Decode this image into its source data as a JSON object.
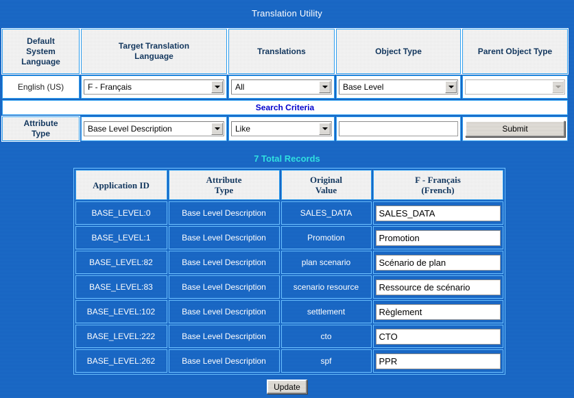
{
  "page": {
    "title": "Translation Utility",
    "background_color": "#1565c5",
    "accent_cyan": "#2fe0e0",
    "accent_blue": "#0000cc",
    "header_text_color": "#13375e"
  },
  "criteria": {
    "headers": [
      "Default System Language",
      "Target Translation Language",
      "Translations",
      "Object Type",
      "Parent Object Type"
    ],
    "header_lines": {
      "default_system_language": [
        "Default",
        "System",
        "Language"
      ],
      "target_translation_language": [
        "Target Translation",
        "Language"
      ],
      "translations": [
        "Translations"
      ],
      "object_type": [
        "Object Type"
      ],
      "parent_object_type": [
        "Parent Object Type"
      ]
    },
    "default_system_language_value": "English (US)",
    "target_translation_language_value": "F - Français",
    "translations_value": "All",
    "object_type_value": "Base Level",
    "parent_object_type_value": ""
  },
  "search": {
    "banner": "Search Criteria",
    "attribute_type_label_lines": [
      "Attribute",
      "Type"
    ],
    "attribute_type_label": "Attribute Type",
    "attribute_type_value": "Base Level Description",
    "operator_value": "Like",
    "search_text_value": "",
    "search_text_placeholder": "",
    "submit_label": "Submit"
  },
  "results": {
    "total_records_text": "7 Total Records",
    "columns": [
      {
        "lines": [
          "Application ID"
        ],
        "text": "Application ID"
      },
      {
        "lines": [
          "Attribute",
          "Type"
        ],
        "text": "Attribute Type"
      },
      {
        "lines": [
          "Original",
          "Value"
        ],
        "text": "Original Value"
      },
      {
        "lines": [
          "F - Français",
          "(French)"
        ],
        "text": "F - Français (French)"
      }
    ],
    "rows": [
      {
        "application_id": "BASE_LEVEL:0",
        "attribute_type": "Base Level Description",
        "original_value": "SALES_DATA",
        "translation": "SALES_DATA"
      },
      {
        "application_id": "BASE_LEVEL:1",
        "attribute_type": "Base Level Description",
        "original_value": "Promotion",
        "translation": "Promotion"
      },
      {
        "application_id": "BASE_LEVEL:82",
        "attribute_type": "Base Level Description",
        "original_value": "plan scenario",
        "translation": "Scénario de plan"
      },
      {
        "application_id": "BASE_LEVEL:83",
        "attribute_type": "Base Level Description",
        "original_value": "scenario resource",
        "translation": "Ressource de scénario"
      },
      {
        "application_id": "BASE_LEVEL:102",
        "attribute_type": "Base Level Description",
        "original_value": "settlement",
        "translation": "Règlement"
      },
      {
        "application_id": "BASE_LEVEL:222",
        "attribute_type": "Base Level Description",
        "original_value": "cto",
        "translation": "CTO"
      },
      {
        "application_id": "BASE_LEVEL:262",
        "attribute_type": "Base Level Description",
        "original_value": "spf",
        "translation": "PPR"
      }
    ],
    "update_label": "Update"
  },
  "icons": {
    "dropdown_arrow": "chevron-down-icon"
  }
}
